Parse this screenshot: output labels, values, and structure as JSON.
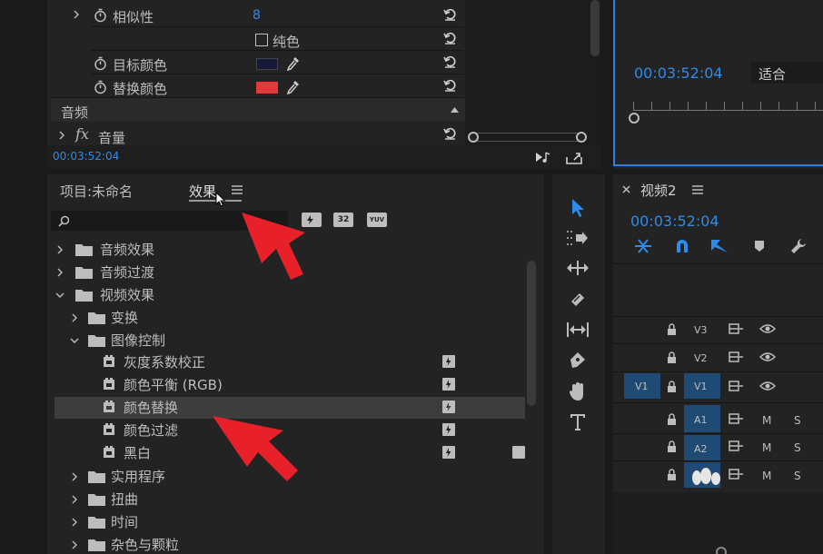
{
  "effect_controls": {
    "rows": [
      {
        "label": "相似性",
        "value": "8"
      },
      {
        "label": "纯色"
      },
      {
        "label": "目标颜色",
        "swatch": "#161a3a"
      },
      {
        "label": "替换颜色",
        "swatch": "#e23a3a"
      }
    ],
    "audio_header": "音频",
    "volume_label": "音量",
    "timecode": "00:03:52:04"
  },
  "program_monitor": {
    "timecode": "00:03:52:04",
    "fit_label": "适合"
  },
  "project_panel": {
    "tab_project": "项目:未命名",
    "tab_effects": "效果",
    "search_placeholder": "",
    "badges": [
      "32",
      "YUV"
    ],
    "tree": [
      {
        "label": "音频效果",
        "level": 0,
        "expanded": false
      },
      {
        "label": "音频过渡",
        "level": 0,
        "expanded": false
      },
      {
        "label": "视频效果",
        "level": 0,
        "expanded": true
      },
      {
        "label": "变换",
        "level": 1,
        "expanded": false
      },
      {
        "label": "图像控制",
        "level": 1,
        "expanded": true
      },
      {
        "label": "灰度系数校正",
        "level": 2
      },
      {
        "label": "颜色平衡 (RGB)",
        "level": 2
      },
      {
        "label": "颜色替换",
        "level": 2,
        "selected": true
      },
      {
        "label": "颜色过滤",
        "level": 2
      },
      {
        "label": "黑白",
        "level": 2
      },
      {
        "label": "实用程序",
        "level": 1,
        "expanded": false
      },
      {
        "label": "扭曲",
        "level": 1,
        "expanded": false
      },
      {
        "label": "时间",
        "level": 1,
        "expanded": false
      },
      {
        "label": "杂色与颗粒",
        "level": 1,
        "expanded": false
      }
    ]
  },
  "timeline": {
    "title": "视频2",
    "timecode": "00:03:52:04",
    "tracks": {
      "v3": "V3",
      "v2": "V2",
      "v1": "V1",
      "a1": "A1",
      "a2": "A2",
      "m": "M",
      "s": "S"
    }
  },
  "colors": {
    "accent_blue": "#2d8ceb",
    "arrow_red": "#e8202a",
    "selection": "#3d3d3d"
  }
}
